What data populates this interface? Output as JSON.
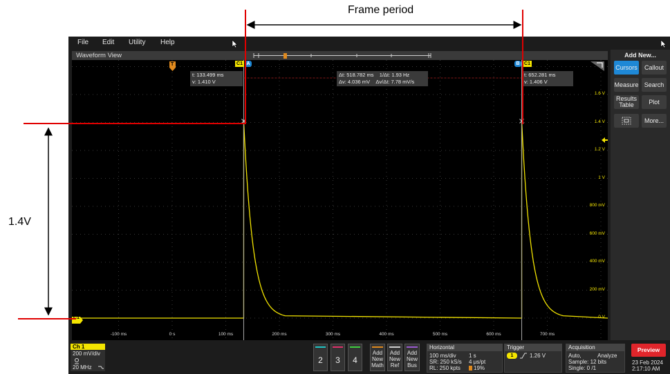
{
  "annotations": {
    "frame_period": "Frame period",
    "amplitude": "1.4V"
  },
  "menu": [
    "File",
    "Edit",
    "Utility",
    "Help"
  ],
  "waveform_view": {
    "title": "Waveform View",
    "y_ticks": [
      "1.6 V",
      "1.4 V",
      "1.2 V",
      "1 V",
      "800 mV",
      "600 mV",
      "400 mV",
      "200 mV",
      "0 V"
    ],
    "x_ticks": [
      "-100 ms",
      "0 s",
      "100 ms",
      "200 ms",
      "300 ms",
      "400 ms",
      "500 ms",
      "600 ms",
      "700 ms"
    ],
    "channel_marker": "C1",
    "trigger_marker": "T",
    "cursor_a": {
      "label": "A",
      "channel": "C1",
      "readout_t": "t: 133.499 ms",
      "readout_v": "v: 1.410 V"
    },
    "cursor_b": {
      "label": "B",
      "channel": "C1",
      "readout_t": "t: 652.281 ms",
      "readout_v": "v: 1.406 V"
    },
    "delta": {
      "dt": "Δt: 518.782 ms",
      "inv_dt": "1/Δt: 1.93 Hz",
      "dv": "Δv: 4.036 mV",
      "dv_dt": "Δv/Δt: 7.78 mV/s"
    }
  },
  "right_panel": {
    "header": "Add New...",
    "buttons": [
      "Cursors",
      "Callout",
      "Measure",
      "Search",
      "Results Table",
      "Plot",
      "",
      "More..."
    ]
  },
  "bottom": {
    "ch1": {
      "title": "Ch 1",
      "scale": "200 mV/div",
      "bw": "20 MHz"
    },
    "channels": [
      "2",
      "3",
      "4"
    ],
    "add_buttons": [
      [
        "Add",
        "New",
        "Math"
      ],
      [
        "Add",
        "New",
        "Ref"
      ],
      [
        "Add",
        "New",
        "Bus"
      ]
    ],
    "horizontal": {
      "title": "Horizontal",
      "r1a": "100 ms/div",
      "r1b": "1 s",
      "r2a": "SR: 250 kS/s",
      "r2b": "4 μs/pt",
      "r3a": "RL: 250 kpts",
      "r3b": "19%"
    },
    "trigger": {
      "title": "Trigger",
      "ch": "1",
      "level": "1.26 V"
    },
    "acquisition": {
      "title": "Acquisition",
      "r1a": "Auto,",
      "r1b": "Analyze",
      "r2": "Sample: 12 bits",
      "r3": "Single: 0 /1"
    },
    "preview": "Preview",
    "date": "23 Feb 2024",
    "time": "2:17:10 AM"
  },
  "colors": {
    "trace": "#f4e500",
    "cursor_badge": "#1e88d6",
    "annotation_red": "#e00000",
    "preview": "#e0252b"
  }
}
